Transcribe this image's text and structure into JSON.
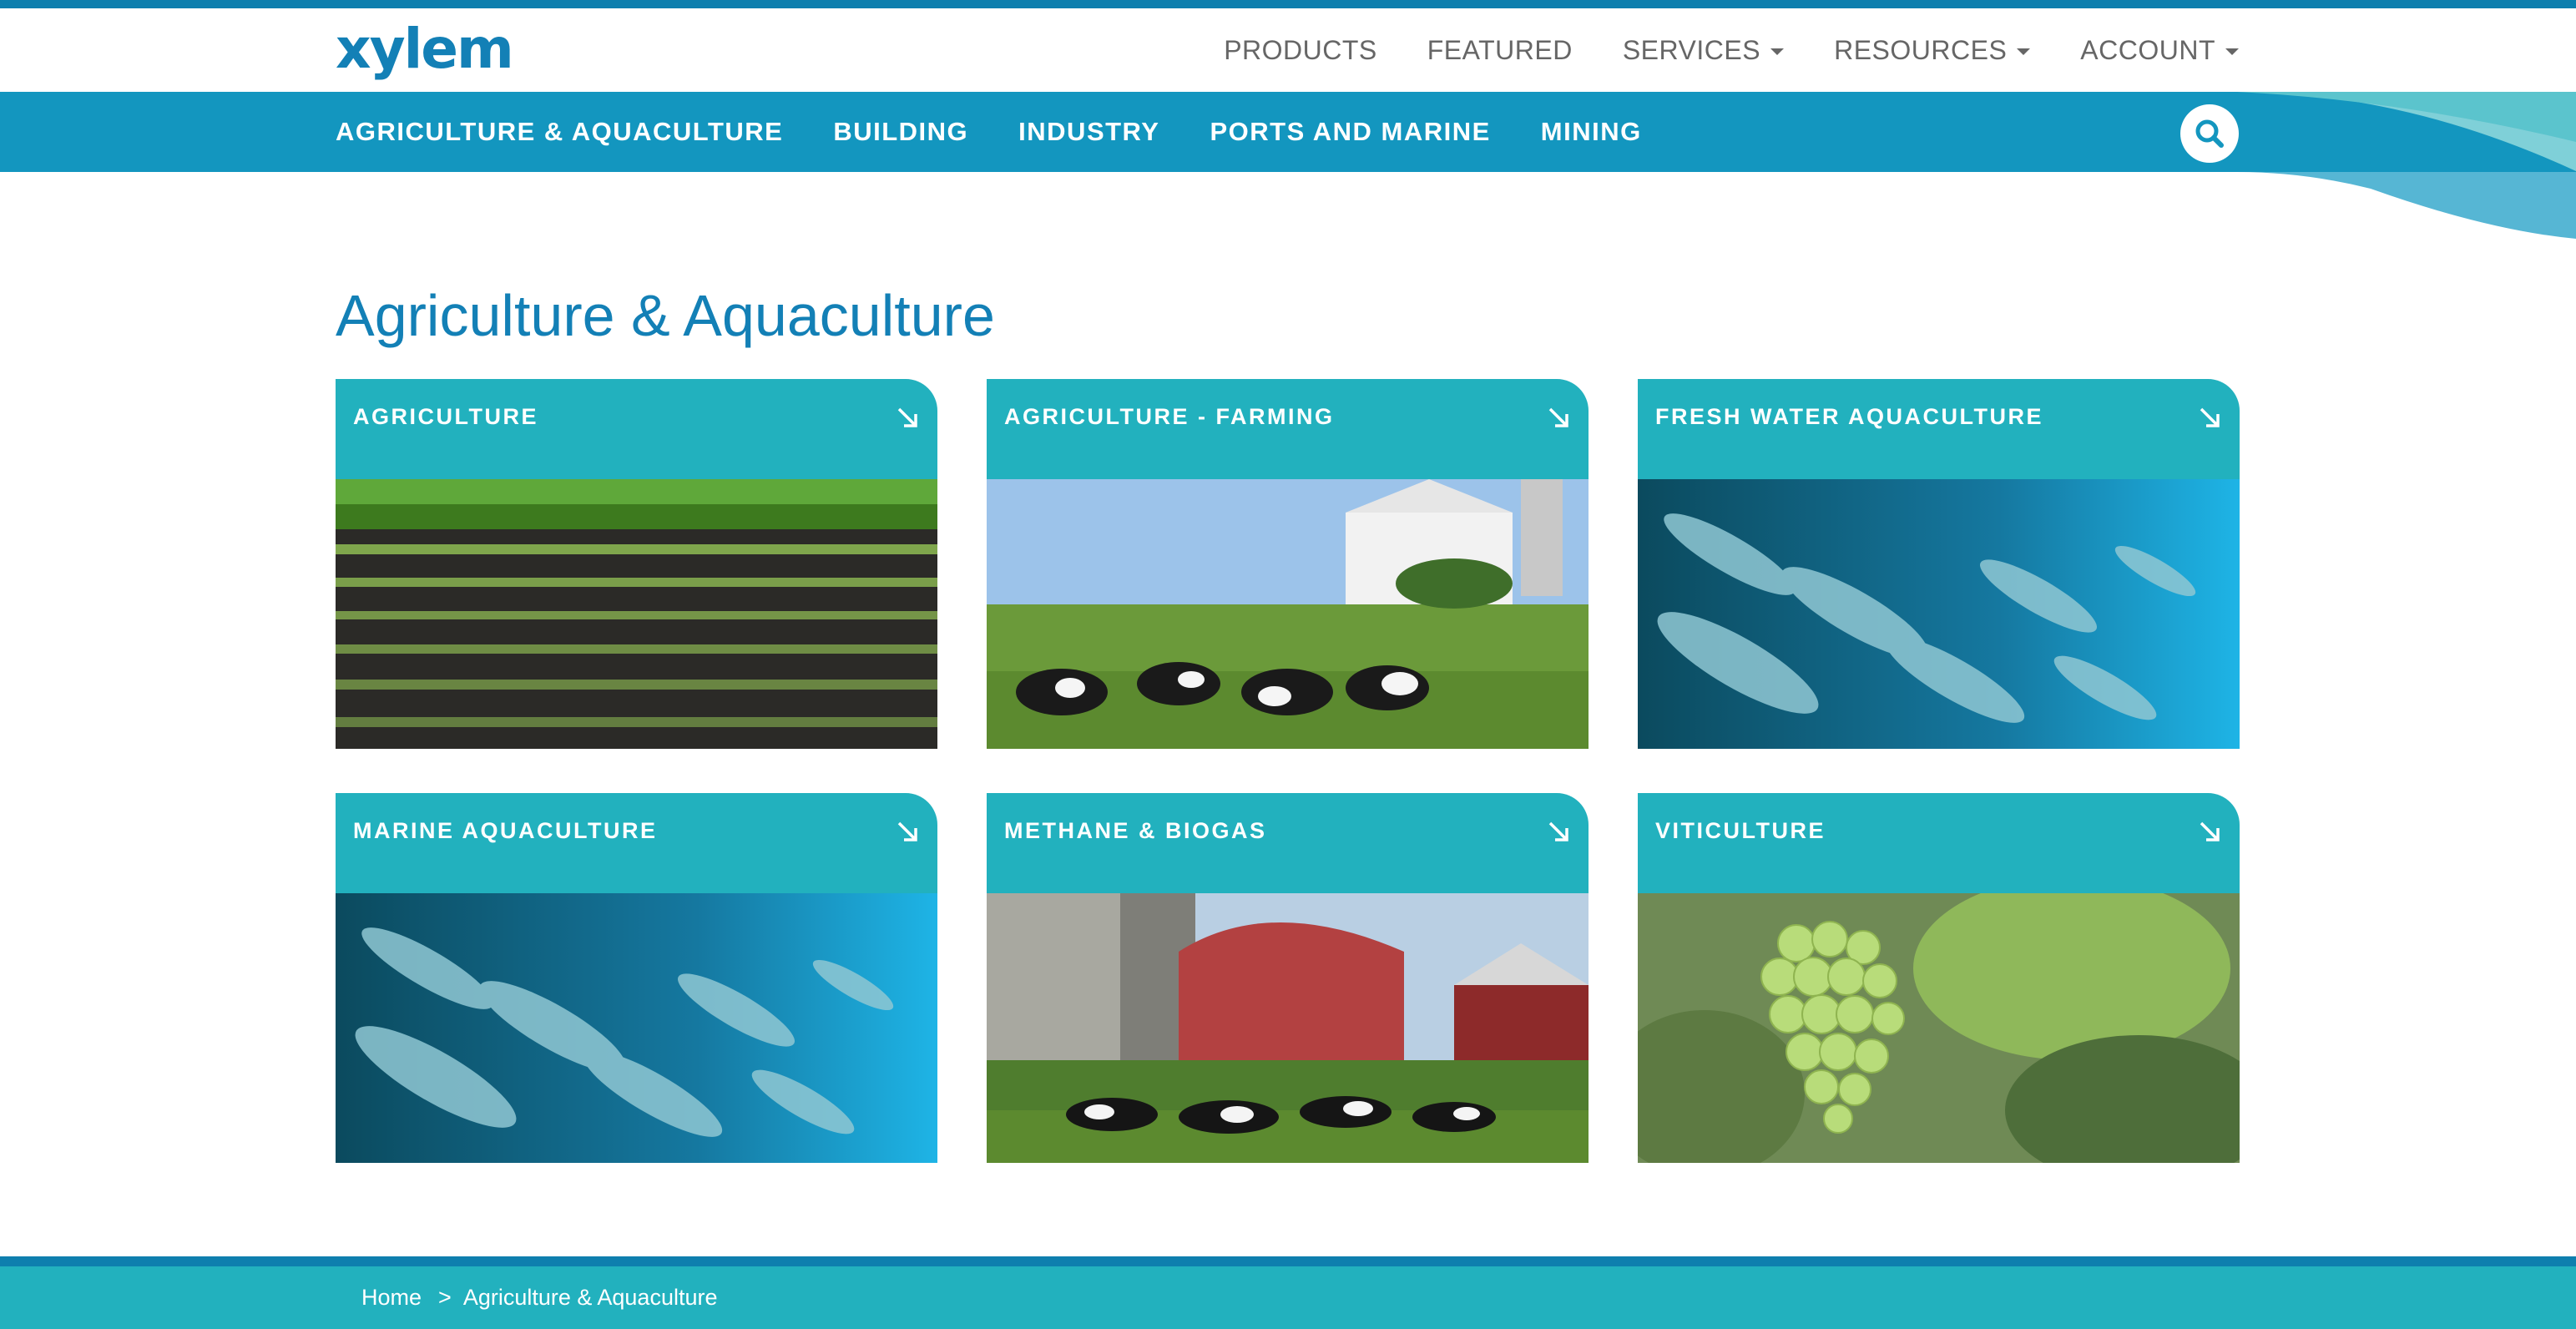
{
  "brand": {
    "logo_text": "xylem",
    "primary": "#1380b6",
    "nav_bg": "#1396bf",
    "card_bg": "#22b1be"
  },
  "util_nav": [
    {
      "label": "PRODUCTS",
      "dropdown": false
    },
    {
      "label": "FEATURED",
      "dropdown": false
    },
    {
      "label": "SERVICES",
      "dropdown": true
    },
    {
      "label": "RESOURCES",
      "dropdown": true
    },
    {
      "label": "ACCOUNT",
      "dropdown": true
    }
  ],
  "main_nav": [
    {
      "label": "AGRICULTURE & AQUACULTURE"
    },
    {
      "label": "BUILDING"
    },
    {
      "label": "INDUSTRY"
    },
    {
      "label": "PORTS AND MARINE"
    },
    {
      "label": "MINING"
    }
  ],
  "search": {
    "icon": "search-icon"
  },
  "page": {
    "title": "Agriculture & Aquaculture"
  },
  "cards": [
    {
      "title": "AGRICULTURE",
      "image": "crop-field-photo",
      "icon": "arrow-down-right-icon"
    },
    {
      "title": "AGRICULTURE - FARMING",
      "image": "dairy-farm-cows-photo",
      "icon": "arrow-down-right-icon"
    },
    {
      "title": "FRESH WATER AQUACULTURE",
      "image": "fish-school-photo",
      "icon": "arrow-down-right-icon"
    },
    {
      "title": "MARINE AQUACULTURE",
      "image": "fish-school-photo",
      "icon": "arrow-down-right-icon"
    },
    {
      "title": "METHANE & BIOGAS",
      "image": "red-barn-cows-photo",
      "icon": "arrow-down-right-icon"
    },
    {
      "title": "VITICULTURE",
      "image": "grapes-vine-photo",
      "icon": "arrow-down-right-icon"
    }
  ],
  "breadcrumb": {
    "home": "Home",
    "separator": ">",
    "current": "Agriculture & Aquaculture"
  }
}
